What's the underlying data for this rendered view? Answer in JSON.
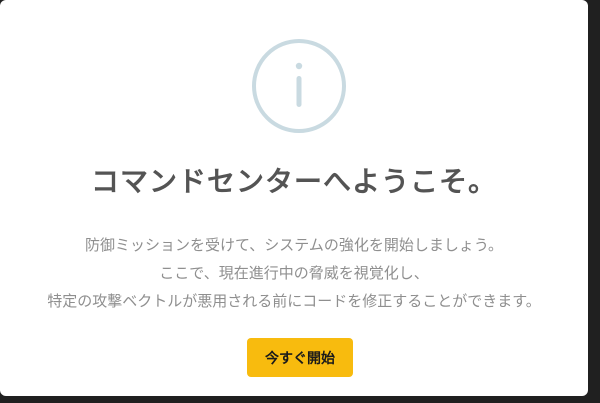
{
  "dialog": {
    "title": "コマンドセンターへようこそ。",
    "message_lines": [
      "防御ミッションを受けて、システムの強化を開始しましょう。",
      "ここで、現在進行中の脅威を視覚化し、",
      "特定の攻撃ベクトルが悪用される前にコードを修正することができます。"
    ],
    "start_button_label": "今すぐ開始",
    "icon": "info-icon"
  },
  "colors": {
    "accent": "#f8bb0e",
    "icon_ring": "#c9dae1",
    "title": "#545454",
    "body_text": "#8f8f8f"
  }
}
